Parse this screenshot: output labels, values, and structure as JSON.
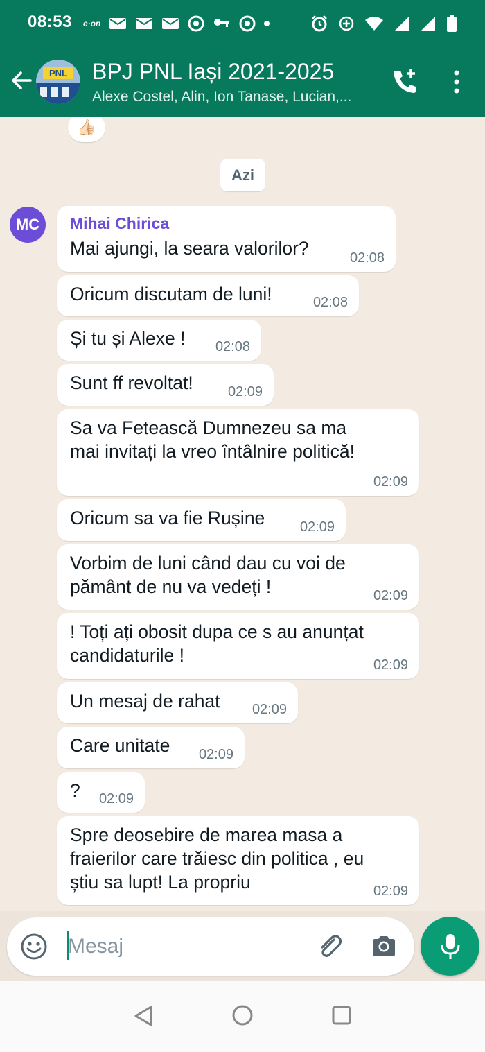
{
  "status_bar": {
    "time": "08:53",
    "carrier_logo": "e·on",
    "icons": [
      "mail-icon",
      "mail-icon",
      "mail-icon",
      "chrome-icon",
      "key-icon",
      "chrome-icon",
      "alarm-icon",
      "data-saver-icon",
      "wifi-icon",
      "signal-icon",
      "signal-icon",
      "battery-icon"
    ]
  },
  "header": {
    "title": "BPJ PNL Iași 2021-2025",
    "subtitle": "Alexe Costel, Alin, Ion Tanase, Lucian,...",
    "avatar_logo_text": "PNL",
    "accent_color": "#077a5d"
  },
  "chat": {
    "reaction_emoji": "👍🏻",
    "date_label": "Azi",
    "sender_initials": "MC",
    "sender_name": "Mihai Chirica",
    "sender_color": "#6c4dd8",
    "messages": [
      {
        "lines": [
          "Mai ajungi, la seara valorilor?"
        ],
        "time": "02:08"
      },
      {
        "lines": [
          "Oricum discutam de luni!"
        ],
        "time": "02:08"
      },
      {
        "lines": [
          "Și tu și Alexe !"
        ],
        "time": "02:08"
      },
      {
        "lines": [
          "Sunt ff revoltat!"
        ],
        "time": "02:09"
      },
      {
        "lines": [
          "Sa va Fetească Dumnezeu sa ma",
          "mai invitați la vreo întâlnire politică!"
        ],
        "time": "02:09"
      },
      {
        "lines": [
          "Oricum sa va fie Rușine"
        ],
        "time": "02:09"
      },
      {
        "lines": [
          "Vorbim de luni când dau cu voi de",
          "pământ de nu va vedeți !"
        ],
        "time": "02:09"
      },
      {
        "lines": [
          "! Toți  ați obosit dupa ce s au anunțat",
          "candidaturile !"
        ],
        "time": "02:09"
      },
      {
        "lines": [
          "Un mesaj de rahat"
        ],
        "time": "02:09"
      },
      {
        "lines": [
          "Care unitate"
        ],
        "time": "02:09"
      },
      {
        "lines": [
          "?"
        ],
        "time": "02:09"
      },
      {
        "lines": [
          "Spre deosebire de marea masa a",
          "fraierilor care trăiesc din politica , eu",
          "știu sa lupt! La propriu"
        ],
        "time": "02:09"
      }
    ]
  },
  "composer": {
    "placeholder": "Mesaj",
    "value": ""
  }
}
